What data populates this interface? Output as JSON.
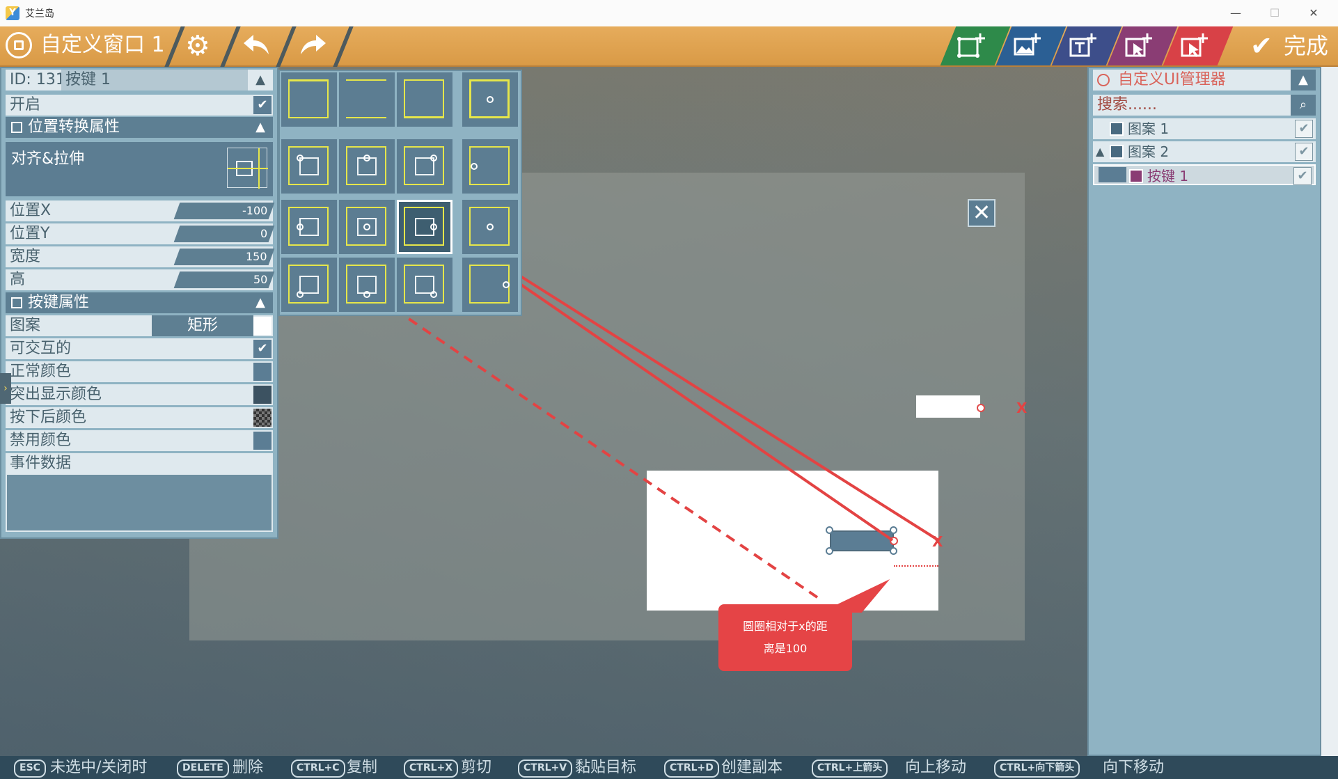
{
  "os": {
    "title": "艾兰岛",
    "icon_letter": "Y",
    "controls": {
      "minimize": "—",
      "maximize": "☐",
      "close": "✕"
    }
  },
  "toolbar": {
    "window_title": "自定义窗口 1",
    "settings_icon": "gear-icon",
    "undo_icon": "undo-icon",
    "redo_icon": "redo-icon",
    "add_buttons": [
      {
        "name": "add-panel-button",
        "color": "#2e8a4a"
      },
      {
        "name": "add-image-button",
        "color": "#2b5f94"
      },
      {
        "name": "add-text-button",
        "color": "#3d4e8a"
      },
      {
        "name": "add-button-button",
        "color": "#8a3d74"
      },
      {
        "name": "add-input-button",
        "color": "#d84147"
      }
    ],
    "done_label": "完成"
  },
  "left_panel": {
    "id_label": "ID: 131",
    "name_value": "按键 1",
    "enable_label": "开启",
    "position_section": "位置转换属性",
    "align_label": "对齐&拉伸",
    "fields": [
      {
        "label": "位置X",
        "value": "-100"
      },
      {
        "label": "位置Y",
        "value": "0"
      },
      {
        "label": "宽度",
        "value": "150"
      },
      {
        "label": "高",
        "value": "50"
      }
    ],
    "button_section": "按键属性",
    "pattern_label": "图案",
    "pattern_value": "矩形",
    "interactable_label": "可交互的",
    "colors": [
      {
        "label": "正常颜色",
        "color": "#5b7d94"
      },
      {
        "label": "突出显示颜色",
        "color": "#3c5261"
      },
      {
        "label": "按下后颜色",
        "color": "#4a4a4a"
      },
      {
        "label": "禁用颜色",
        "color": "#5b7d94"
      }
    ],
    "event_label": "事件数据"
  },
  "annotation": {
    "x_marker": "X",
    "callout_line1": "圆圈相对于x的距",
    "callout_line2": "离是100"
  },
  "right_panel": {
    "title": "自定义UI管理器",
    "search_placeholder": "搜索......",
    "items": [
      {
        "label": "图案 1",
        "type": "image",
        "checked": true
      },
      {
        "label": "图案 2",
        "type": "image",
        "checked": true
      },
      {
        "label": "按键 1",
        "type": "button",
        "checked": true
      }
    ]
  },
  "shortcuts": [
    {
      "key": "ESC",
      "desc": "未选中/关闭时"
    },
    {
      "key": "DELETE",
      "desc": "删除"
    },
    {
      "key": "CTRL+C",
      "desc": "复制"
    },
    {
      "key": "CTRL+X",
      "desc": "剪切"
    },
    {
      "key": "CTRL+V",
      "desc": "黏贴目标"
    },
    {
      "key": "CTRL+D",
      "desc": "创建副本"
    },
    {
      "key": "CTRL+上箭头",
      "desc": "向上移动"
    },
    {
      "key": "CTRL+向下箭头",
      "desc": "向下移动"
    }
  ]
}
